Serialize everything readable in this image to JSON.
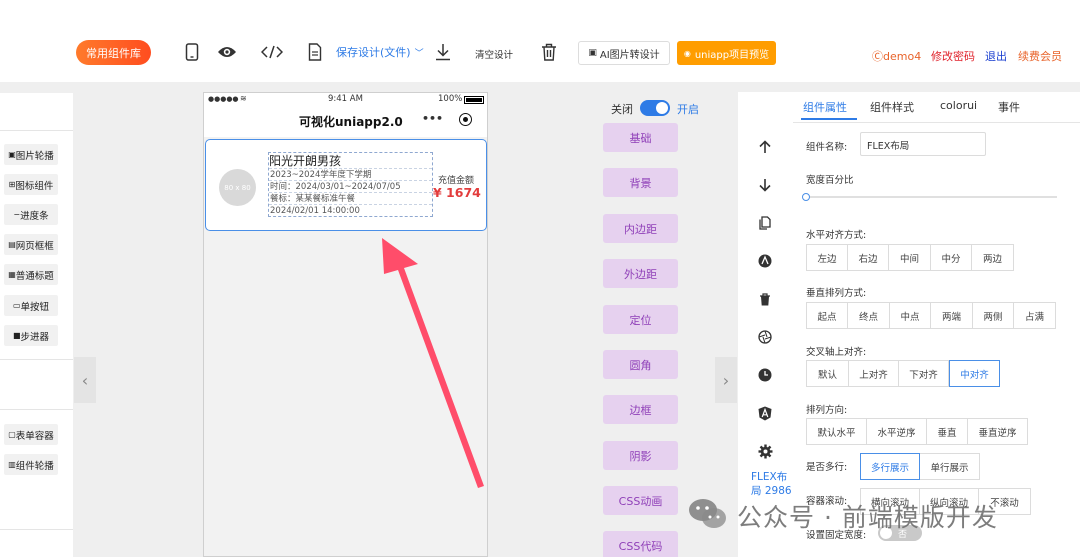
{
  "toolbar": {
    "common_components": "常用组件库",
    "save_design": "保存设计(文件)",
    "clear_design": "清空设计",
    "ai_image": "AI图片转设计",
    "uniapp_preview": "uniapp项目预览",
    "user": "demo4",
    "change_password": "修改密码",
    "logout": "退出",
    "renew": "续费会员"
  },
  "left_panel": {
    "items_top": [
      "图片轮播",
      "图标组件",
      "进度条",
      "网页框框",
      "普通标题",
      "单按钮",
      "步进器"
    ],
    "items_bottom": [
      "表单容器",
      "组件轮播"
    ]
  },
  "phone": {
    "status": {
      "carrier": "●●●●● ",
      "time": "9:41 AM",
      "battery": "100%"
    },
    "title": "可视化uniapp2.0",
    "card": {
      "avatar_text": "80 x 80",
      "name": "阳光开朗男孩",
      "term": "2023~2024学年度下学期",
      "time": "时间：2024/03/01~2024/07/05",
      "meal": "餐标：某某餐标准午餐",
      "date": "2024/02/01 14:00:00",
      "amount_label": "充值金额",
      "amount": "¥ 1674"
    }
  },
  "toggle": {
    "off_label": "关闭",
    "on_label": "开启",
    "state": true
  },
  "style_buttons": [
    "基础",
    "背景",
    "内边距",
    "外边距",
    "定位",
    "圆角",
    "边框",
    "阴影",
    "CSS动画",
    "CSS代码"
  ],
  "tool_column": {
    "icons": [
      "arrow-up-icon",
      "arrow-down-icon",
      "copy-icon",
      "compass-icon",
      "trash-icon",
      "aperture-icon",
      "clock-icon",
      "angular-icon",
      "gear-icon"
    ],
    "component_name_line1": "FLEX布",
    "component_name_line2": "局 2986"
  },
  "props": {
    "tabs": [
      "组件属性",
      "组件样式",
      "colorui",
      "事件"
    ],
    "active_tab": 0,
    "name_label": "组件名称:",
    "name_value": "FLEX布局",
    "width_label": "宽度百分比",
    "width_percent": 0,
    "h_align_label": "水平对齐方式:",
    "h_align": [
      "左边",
      "右边",
      "中间",
      "中分",
      "两边"
    ],
    "v_align_label": "垂直排列方式:",
    "v_align": [
      "起点",
      "终点",
      "中点",
      "两端",
      "两侧",
      "占满"
    ],
    "cross_label": "交叉轴上对齐:",
    "cross": [
      "默认",
      "上对齐",
      "下对齐",
      "中对齐"
    ],
    "cross_active": 3,
    "dir_label": "排列方向:",
    "dir": [
      "默认水平",
      "水平逆序",
      "垂直",
      "垂直逆序"
    ],
    "wrap_label": "是否多行:",
    "wrap": [
      "多行展示",
      "单行展示"
    ],
    "wrap_active": 0,
    "scroll_label": "容器滚动:",
    "scroll": [
      "横向滚动",
      "纵向滚动",
      "不滚动"
    ],
    "fixed_width_label": "设置固定宽度:",
    "fixed_width_toggle": "否"
  },
  "watermark": "公众号 · 前端模版开发",
  "colors": {
    "accent": "#4a8fe7",
    "orange": "#ff7a2b",
    "preview": "#ff9d00",
    "purple_btn": "#e6d1ef",
    "price": "#e23c3c",
    "arrow": "#ff4d6a"
  }
}
